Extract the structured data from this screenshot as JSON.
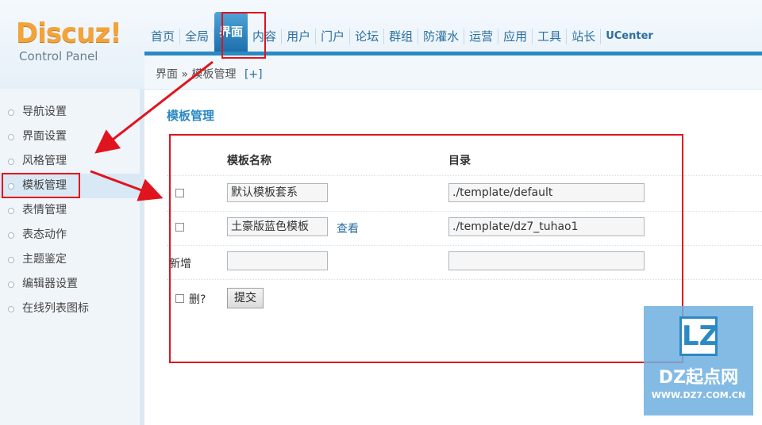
{
  "logo": {
    "main": "Discuz!",
    "sub": "Control Panel"
  },
  "nav": {
    "items": [
      {
        "label": "首页"
      },
      {
        "label": "全局"
      },
      {
        "label": "界面",
        "active": true
      },
      {
        "label": "内容"
      },
      {
        "label": "用户"
      },
      {
        "label": "门户"
      },
      {
        "label": "论坛"
      },
      {
        "label": "群组"
      },
      {
        "label": "防灌水"
      },
      {
        "label": "运营"
      },
      {
        "label": "应用"
      },
      {
        "label": "工具"
      },
      {
        "label": "站长"
      },
      {
        "label": "UCenter"
      }
    ]
  },
  "breadcrumb": {
    "section": "界面",
    "separator": "»",
    "page": "模板管理",
    "add": "[+]"
  },
  "sidebar": {
    "items": [
      {
        "label": "导航设置"
      },
      {
        "label": "界面设置"
      },
      {
        "label": "风格管理"
      },
      {
        "label": "模板管理",
        "active": true
      },
      {
        "label": "表情管理"
      },
      {
        "label": "表态动作"
      },
      {
        "label": "主题鉴定"
      },
      {
        "label": "编辑器设置"
      },
      {
        "label": "在线列表图标"
      }
    ]
  },
  "main": {
    "title": "模板管理",
    "columns": {
      "name": "模板名称",
      "dir": "目录"
    },
    "rows": [
      {
        "name": "默认模板套系",
        "dir": "./template/default",
        "view": ""
      },
      {
        "name": "土豪版蓝色模板",
        "dir": "./template/dz7_tuhao1",
        "view": "查看"
      }
    ],
    "new_label": "新增",
    "new_name": "",
    "new_dir": "",
    "delete_label": "删?",
    "submit_label": "提交"
  },
  "watermark": {
    "logo": "LZ",
    "name": "DZ起点网",
    "url": "WWW.DZ7.COM.CN"
  },
  "colors": {
    "accent": "#2b89c4",
    "annotation": "#e0141e"
  }
}
